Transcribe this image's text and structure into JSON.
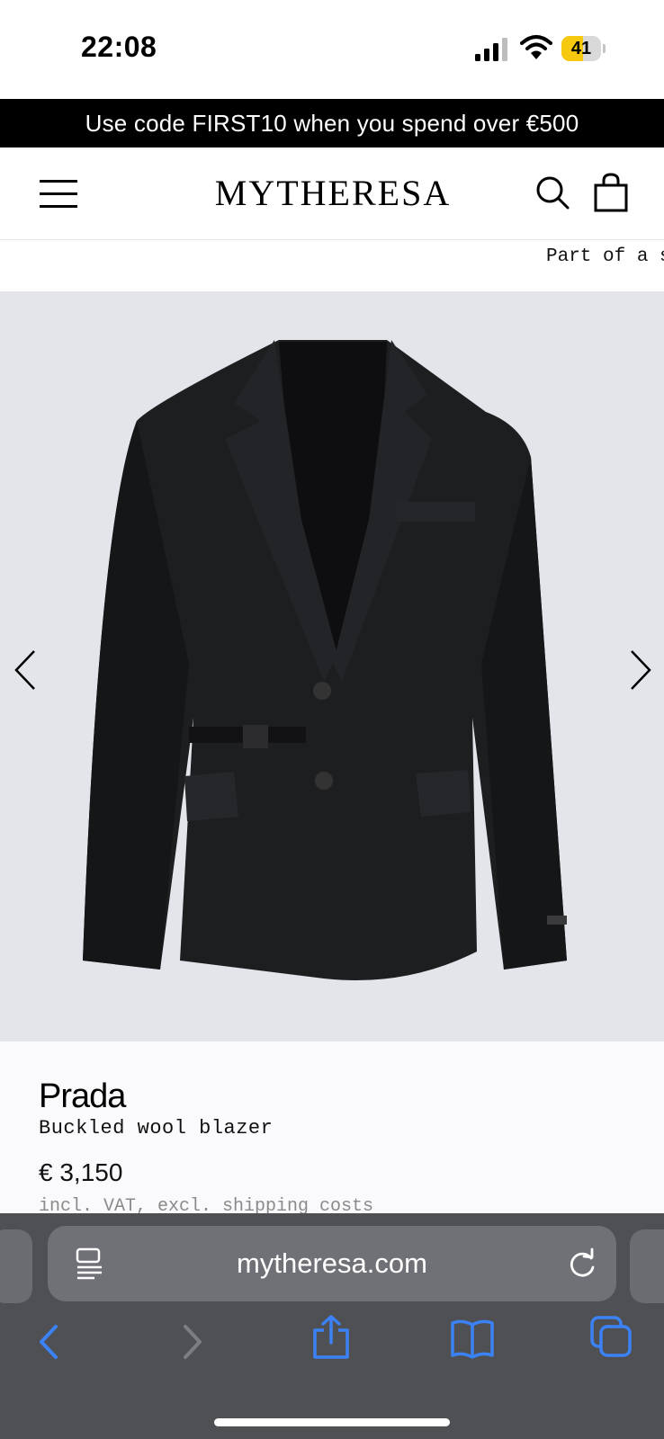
{
  "status_bar": {
    "time": "22:08",
    "battery_level": "41",
    "icons": [
      "signal-icon",
      "wifi-icon",
      "battery-charging-icon"
    ]
  },
  "promo_banner": {
    "text": "Use code FIRST10 when you spend over €500"
  },
  "header": {
    "logo": "MYTHERESA",
    "icons": [
      "menu-icon",
      "search-icon",
      "shopping-bag-icon"
    ]
  },
  "ticker": {
    "text": "Part of a s"
  },
  "gallery": {
    "image_description_icon": "blazer-image",
    "prev_icon": "chevron-left-icon",
    "next_icon": "chevron-right-icon",
    "background_color": "#e3e5ea"
  },
  "product": {
    "brand": "Prada",
    "name": "Buckled wool blazer",
    "price": "€ 3,150",
    "vat_note": "incl. VAT, excl. shipping costs"
  },
  "browser": {
    "url": "mytheresa.com",
    "icons": [
      "reader-icon",
      "reload-icon",
      "back-icon",
      "forward-icon",
      "share-icon",
      "bookmarks-icon",
      "tabs-icon"
    ],
    "accent_color": "#3b82f6"
  }
}
